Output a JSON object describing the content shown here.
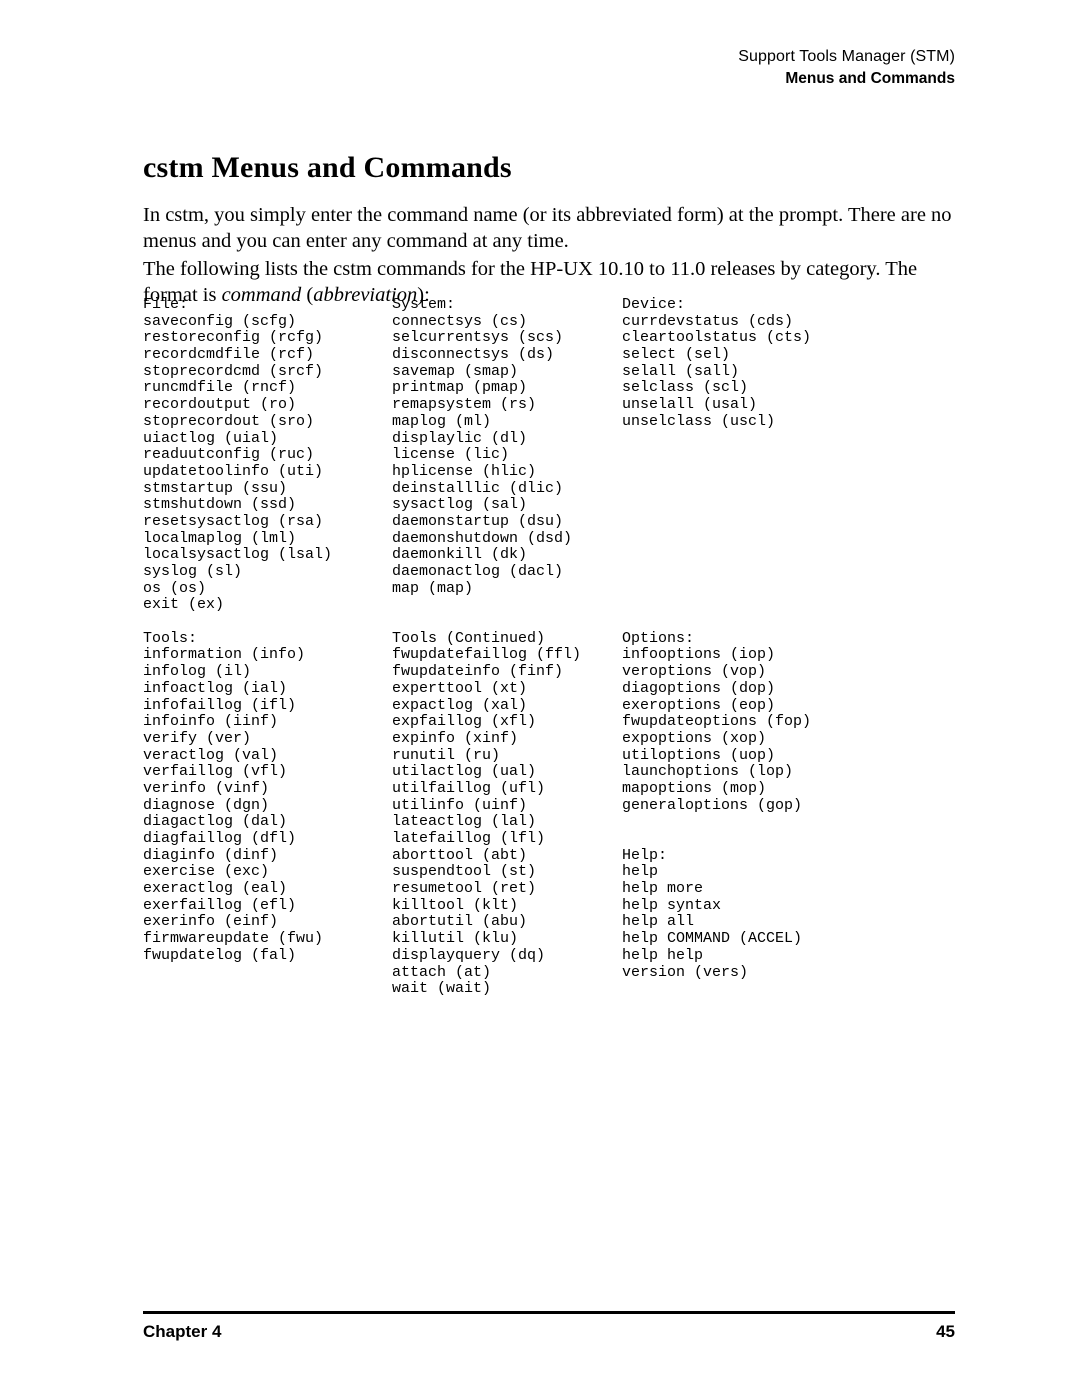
{
  "running_head": {
    "line1": "Support Tools Manager (STM)",
    "line2": "Menus and Commands"
  },
  "heading": "cstm Menus and Commands",
  "paragraphs": {
    "p1": "In cstm, you simply enter the command name (or its abbreviated form) at the prompt. There are no menus and you can enter any command at any time.",
    "p2_before": "The following lists the cstm commands for the HP-UX 10.10 to 11.0 releases by category. The format is ",
    "p2_italic_1": "command",
    "p2_middle": " (",
    "p2_italic_2": "abbreviation",
    "p2_after": "):"
  },
  "command_blocks": [
    {
      "columns": [
        {
          "heading": "File:",
          "lines": [
            "saveconfig (scfg)",
            "restoreconfig (rcfg)",
            "recordcmdfile (rcf)",
            "stoprecordcmd (srcf)",
            "runcmdfile (rncf)",
            "recordoutput (ro)",
            "stoprecordout (sro)",
            "uiactlog (uial)",
            "readuutconfig (ruc)",
            "updatetoolinfo (uti)",
            "stmstartup (ssu)",
            "stmshutdown (ssd)",
            "resetsysactlog (rsa)",
            "localmaplog (lml)",
            "localsysactlog (lsal)",
            "syslog (sl)",
            "os (os)",
            "exit (ex)"
          ]
        },
        {
          "heading": "System:",
          "lines": [
            "connectsys (cs)",
            "selcurrentsys (scs)",
            "disconnectsys (ds)",
            "savemap (smap)",
            "printmap (pmap)",
            "remapsystem (rs)",
            "maplog (ml)",
            "displaylic (dl)",
            "license (lic)",
            "hplicense (hlic)",
            "deinstalllic (dlic)",
            "sysactlog (sal)",
            "daemonstartup (dsu)",
            "daemonshutdown (dsd)",
            "daemonkill (dk)",
            "daemonactlog (dacl)",
            "map (map)"
          ]
        },
        {
          "heading": "Device:",
          "lines": [
            "currdevstatus (cds)",
            "cleartoolstatus (cts)",
            "select (sel)",
            "selall (sall)",
            "selclass (scl)",
            "unselall (usal)",
            "unselclass (uscl)"
          ]
        }
      ]
    },
    {
      "columns": [
        {
          "heading": "Tools:",
          "lines": [
            "information (info)",
            "infolog (il)",
            "infoactlog (ial)",
            "infofaillog (ifl)",
            "infoinfo (iinf)",
            "verify (ver)",
            "veractlog (val)",
            "verfaillog (vfl)",
            "verinfo (vinf)",
            "diagnose (dgn)",
            "diagactlog (dal)",
            "diagfaillog (dfl)",
            "diaginfo (dinf)",
            "exercise (exc)",
            "exeractlog (eal)",
            "exerfaillog (efl)",
            "exerinfo (einf)",
            "firmwareupdate (fwu)",
            "fwupdatelog (fal)"
          ]
        },
        {
          "heading": "Tools (Continued)",
          "lines": [
            "fwupdatefaillog (ffl)",
            "fwupdateinfo (finf)",
            "experttool (xt)",
            "expactlog (xal)",
            "expfaillog (xfl)",
            "expinfo (xinf)",
            "runutil (ru)",
            "utilactlog (ual)",
            "utilfaillog (ufl)",
            "utilinfo (uinf)",
            "lateactlog (lal)",
            "latefaillog (lfl)",
            "aborttool (abt)",
            "suspendtool (st)",
            "resumetool (ret)",
            "killtool (klt)",
            "abortutil (abu)",
            "killutil (klu)",
            "displayquery (dq)",
            "attach (at)",
            "wait (wait)"
          ]
        },
        {
          "heading": "Options:",
          "lines": [
            "infooptions (iop)",
            "veroptions (vop)",
            "diagoptions (dop)",
            "exeroptions (eop)",
            "fwupdateoptions (fop)",
            "expoptions (xop)",
            "utiloptions (uop)",
            "launchoptions (lop)",
            "mapoptions (mop)",
            "generaloptions (gop)",
            "",
            "",
            "Help:",
            "help",
            "help more",
            "help syntax",
            "help all",
            "help COMMAND (ACCEL)",
            "help help",
            "version (vers)"
          ]
        }
      ]
    }
  ],
  "footer": {
    "chapter_label": "Chapter 4",
    "page_number": "45"
  }
}
